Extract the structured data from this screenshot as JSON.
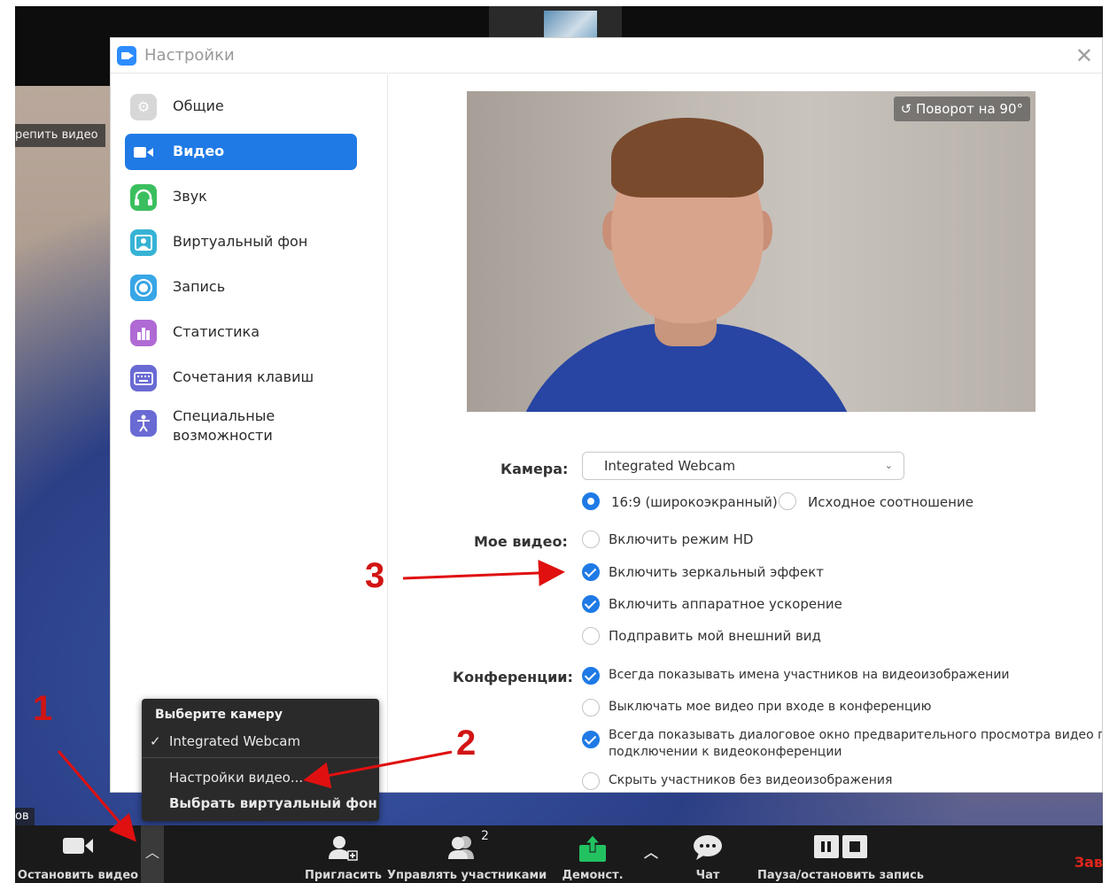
{
  "zoom": {
    "pin_label": "репить видео",
    "name_label": "ов",
    "toolbar": {
      "stop_video": "Остановить видео",
      "invite": "Пригласить",
      "manage": "Управлять участниками",
      "participants_count": "2",
      "share": "Демонст.",
      "chat": "Чат",
      "record": "Пауза/остановить запись",
      "end": "Зав"
    }
  },
  "settings": {
    "title": "Настройки",
    "nav": [
      {
        "label": "Общие",
        "icon": "gear-icon",
        "color": "#c9c9c9"
      },
      {
        "label": "Видео",
        "icon": "video-camera-icon",
        "color": "#1f7ae6",
        "active": true
      },
      {
        "label": "Звук",
        "icon": "headphones-icon",
        "color": "#3bbf5e"
      },
      {
        "label": "Виртуальный фон",
        "icon": "portrait-icon",
        "color": "#36b3d4"
      },
      {
        "label": "Запись",
        "icon": "record-icon",
        "color": "#38a6e6"
      },
      {
        "label": "Статистика",
        "icon": "bar-chart-icon",
        "color": "#b06ad4"
      },
      {
        "label": "Сочетания клавиш",
        "icon": "keyboard-icon",
        "color": "#6a6ad4"
      },
      {
        "label": "Специальные возможности",
        "icon": "accessibility-icon",
        "color": "#6a6ad4"
      }
    ],
    "preview": {
      "rotate_label": "Поворот на 90°"
    },
    "camera": {
      "label": "Камера:",
      "selected": "Integrated Webcam",
      "ratio_wide": "16:9 (широкоэкранный)",
      "ratio_original": "Исходное соотношение"
    },
    "my_video": {
      "label": "Мое видео:",
      "options": [
        {
          "text": "Включить режим HD",
          "checked": false
        },
        {
          "text": "Включить зеркальный эффект",
          "checked": true
        },
        {
          "text": "Включить аппаратное ускорение",
          "checked": true
        },
        {
          "text": "Подправить мой внешний вид",
          "checked": false
        }
      ]
    },
    "meetings": {
      "label": "Конференции:",
      "options": [
        {
          "text": "Всегда показывать имена участников на видеоизображении",
          "checked": true
        },
        {
          "text": "Выключать мое видео при входе в конференцию",
          "checked": false
        },
        {
          "text": "Всегда показывать диалоговое окно предварительного просмотра видео при",
          "text2": "подключении к видеоконференции",
          "checked": true
        },
        {
          "text": "Скрыть участников без видеоизображения",
          "checked": false
        }
      ]
    }
  },
  "camera_menu": {
    "header": "Выберите камеру",
    "camera": "Integrated Webcam",
    "video_settings": "Настройки видео...",
    "virtual_bg": "Выбрать виртуальный фон"
  },
  "annotations": [
    "1",
    "2",
    "3"
  ]
}
